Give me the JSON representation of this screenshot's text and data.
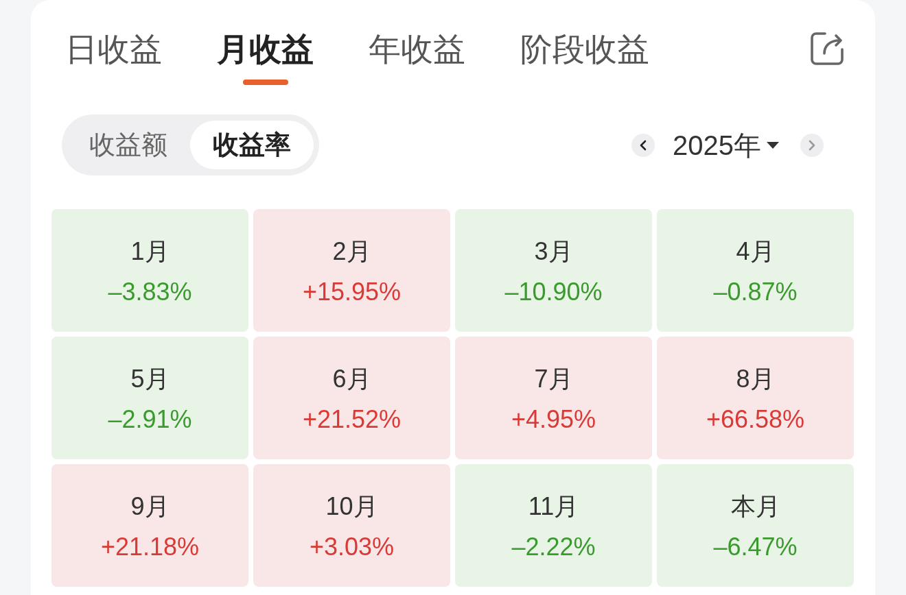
{
  "tabs": [
    {
      "label": "日收益",
      "selected": false
    },
    {
      "label": "月收益",
      "selected": true
    },
    {
      "label": "年收益",
      "selected": false
    },
    {
      "label": "阶段收益",
      "selected": false
    }
  ],
  "toggle": [
    {
      "label": "收益额",
      "selected": false
    },
    {
      "label": "收益率",
      "selected": true
    }
  ],
  "year_picker": {
    "prev": {
      "disabled": false
    },
    "year": "2025年",
    "next": {
      "disabled": true
    }
  },
  "months": [
    {
      "label": "1月",
      "value": "–3.83%",
      "kind": "down"
    },
    {
      "label": "2月",
      "value": "+15.95%",
      "kind": "up"
    },
    {
      "label": "3月",
      "value": "–10.90%",
      "kind": "down"
    },
    {
      "label": "4月",
      "value": "–0.87%",
      "kind": "down"
    },
    {
      "label": "5月",
      "value": "–2.91%",
      "kind": "down"
    },
    {
      "label": "6月",
      "value": "+21.52%",
      "kind": "up"
    },
    {
      "label": "7月",
      "value": "+4.95%",
      "kind": "up"
    },
    {
      "label": "8月",
      "value": "+66.58%",
      "kind": "up"
    },
    {
      "label": "9月",
      "value": "+21.18%",
      "kind": "up"
    },
    {
      "label": "10月",
      "value": "+3.03%",
      "kind": "up"
    },
    {
      "label": "11月",
      "value": "–2.22%",
      "kind": "down"
    },
    {
      "label": "本月",
      "value": "–6.47%",
      "kind": "down"
    }
  ]
}
